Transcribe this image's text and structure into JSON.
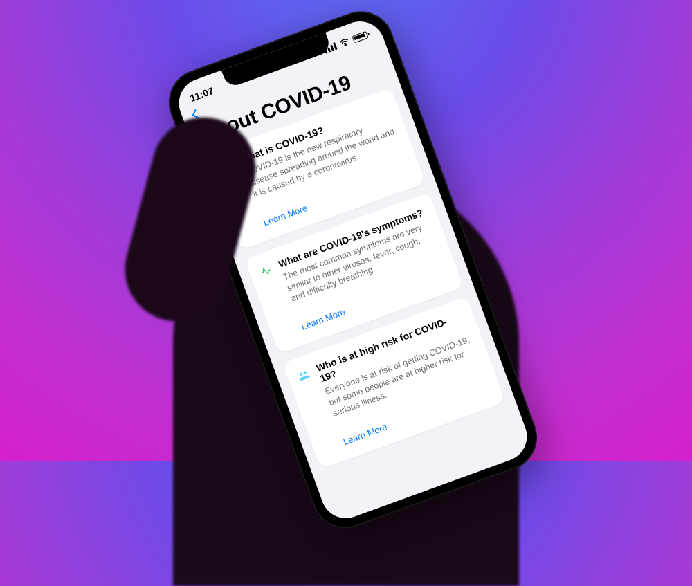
{
  "status": {
    "time": "11:07"
  },
  "nav": {
    "page_title": "About COVID-19"
  },
  "cards": [
    {
      "icon": "virus-icon",
      "title": "What is COVID-19?",
      "body": "COVID-19 is the new respiratory disease spreading around the world and it is caused by a coronavirus.",
      "link": "Learn More"
    },
    {
      "icon": "pulse-icon",
      "title": "What are COVID-19's symptoms?",
      "body": "The most common symptoms are very similar to other viruses: fever, cough, and difficulty breathing.",
      "link": "Learn More"
    },
    {
      "icon": "people-icon",
      "title": "Who is at high risk for COVID-19?",
      "body": "Everyone is at risk of getting COVID-19, but some people are at higher risk for serious illness.",
      "link": "Learn More"
    }
  ],
  "colors": {
    "accent": "#007aff",
    "bg": "#f2f2f7",
    "card": "#ffffff",
    "text": "#000000",
    "subtext": "#6e6e73"
  }
}
